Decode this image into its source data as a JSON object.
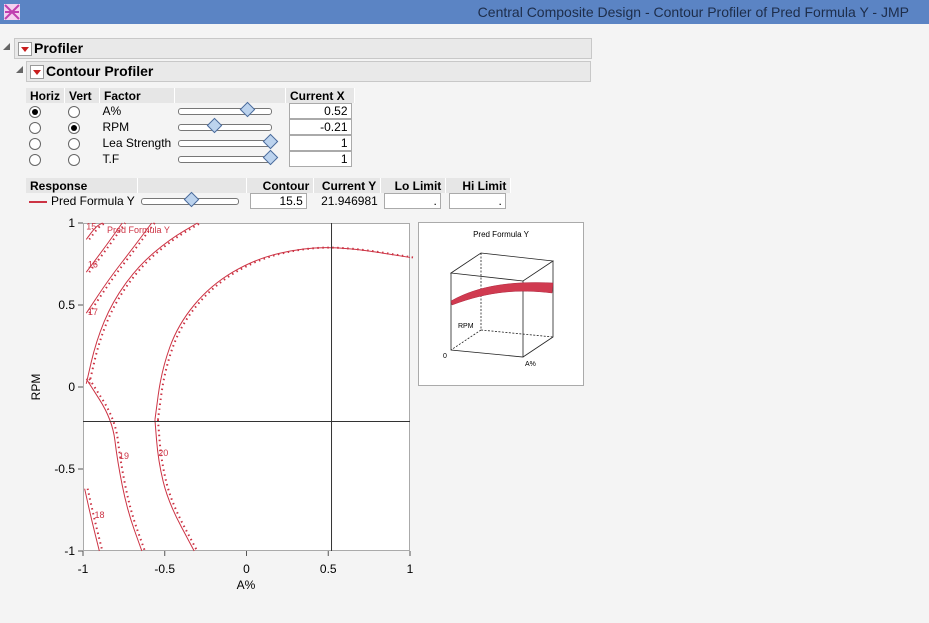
{
  "window": {
    "title": "Central Composite Design - Contour Profiler of Pred Formula Y - JMP"
  },
  "outline": {
    "profiler": "Profiler",
    "contour_profiler": "Contour Profiler"
  },
  "factors": {
    "headers": {
      "horiz": "Horiz",
      "vert": "Vert",
      "factor": "Factor",
      "current_x": "Current X"
    },
    "rows": [
      {
        "name": "A%",
        "value": "0.52",
        "horiz": true,
        "vert": false,
        "slider": 0.76
      },
      {
        "name": "RPM",
        "value": "-0.21",
        "horiz": false,
        "vert": true,
        "slider": 0.395
      },
      {
        "name": "Lea Strength",
        "value": "1",
        "horiz": false,
        "vert": false,
        "slider": 1.0
      },
      {
        "name": "T.F",
        "value": "1",
        "horiz": false,
        "vert": false,
        "slider": 1.0
      }
    ]
  },
  "responses": {
    "headers": {
      "response": "Response",
      "contour": "Contour",
      "current_y": "Current Y",
      "lo_limit": "Lo Limit",
      "hi_limit": "Hi Limit"
    },
    "rows": [
      {
        "name": "Pred Formula Y",
        "contour": "15.5",
        "current_y": "21.946981",
        "lo": ".",
        "hi": ".",
        "color": "#cc3344",
        "slider": 0.52
      }
    ]
  },
  "chart_data": {
    "type": "contour",
    "xlabel": "A%",
    "ylabel": "RPM",
    "xlim": [
      -1,
      1
    ],
    "ylim": [
      -1,
      1
    ],
    "x_ticks": [
      "-1",
      "-0.5",
      "0",
      "0.5",
      "1"
    ],
    "y_ticks": [
      "1",
      "0.5",
      "0",
      "-0.5",
      "-1"
    ],
    "crosshair": {
      "x": 0.52,
      "y": -0.21
    },
    "series_label": "Pred Formula Y",
    "contour_labels": [
      {
        "text": "15",
        "x": -0.98,
        "y": 0.96
      },
      {
        "text": "16",
        "x": -0.97,
        "y": 0.73
      },
      {
        "text": "17",
        "x": -0.97,
        "y": 0.44
      },
      {
        "text": "19",
        "x": -0.78,
        "y": -0.44
      },
      {
        "text": "20",
        "x": -0.54,
        "y": -0.42
      },
      {
        "text": "18",
        "x": -0.93,
        "y": -0.8
      }
    ],
    "contours": [
      {
        "level": 15,
        "points": [
          [
            -0.98,
            0.9
          ],
          [
            -0.92,
            0.98
          ],
          [
            -0.88,
            1.0
          ]
        ]
      },
      {
        "level": 16,
        "points": [
          [
            -0.98,
            0.7
          ],
          [
            -0.86,
            0.86
          ],
          [
            -0.76,
            1.0
          ]
        ]
      },
      {
        "level": 17,
        "points": [
          [
            -0.98,
            0.45
          ],
          [
            -0.84,
            0.66
          ],
          [
            -0.7,
            0.84
          ],
          [
            -0.58,
            1.0
          ]
        ]
      },
      {
        "level": 18,
        "points": [
          [
            -0.99,
            -0.62
          ],
          [
            -0.95,
            -0.8
          ],
          [
            -0.9,
            -1.0
          ]
        ]
      },
      {
        "level": 19,
        "points": [
          [
            -0.98,
            0.05
          ],
          [
            -0.82,
            -0.2
          ],
          [
            -0.79,
            -0.45
          ],
          [
            -0.73,
            -0.75
          ],
          [
            -0.64,
            -1.0
          ]
        ]
      },
      {
        "level": 19,
        "points": [
          [
            -0.98,
            0.02
          ],
          [
            -0.92,
            0.28
          ],
          [
            -0.82,
            0.52
          ],
          [
            -0.66,
            0.74
          ],
          [
            -0.47,
            0.9
          ],
          [
            -0.3,
            1.0
          ]
        ]
      },
      {
        "level": 20,
        "points": [
          [
            -0.56,
            -0.2
          ],
          [
            -0.54,
            -0.45
          ],
          [
            -0.48,
            -0.7
          ],
          [
            -0.32,
            -1.0
          ]
        ]
      },
      {
        "level": 20,
        "points": [
          [
            -0.56,
            -0.2
          ],
          [
            -0.52,
            0.1
          ],
          [
            -0.42,
            0.38
          ],
          [
            -0.22,
            0.62
          ],
          [
            0.05,
            0.78
          ],
          [
            0.35,
            0.85
          ],
          [
            0.62,
            0.85
          ],
          [
            1.0,
            0.79
          ]
        ]
      }
    ]
  },
  "surface_plot": {
    "title": "Pred Formula Y",
    "x_label": "A%",
    "y_label": "RPM",
    "zero_label": "0"
  }
}
